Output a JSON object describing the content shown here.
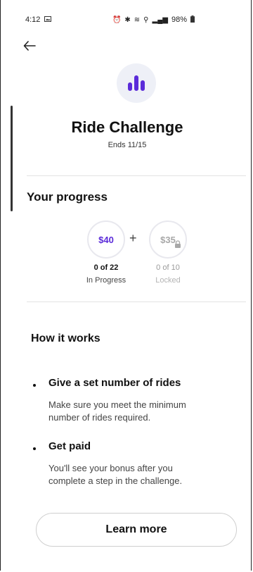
{
  "status_bar": {
    "time": "4:12",
    "battery": "98%",
    "icons": [
      "picture-icon",
      "alarm-icon",
      "bluetooth-icon",
      "wifi-icon",
      "location-icon",
      "signal-icon",
      "battery-icon"
    ]
  },
  "header": {
    "back_icon": "arrow-left-icon"
  },
  "challenge": {
    "icon": "bar-chart-icon",
    "title": "Ride Challenge",
    "ends": "Ends 11/15",
    "accent_color": "#5b2bd9"
  },
  "progress": {
    "heading": "Your progress",
    "plus": "+",
    "tiers": [
      {
        "amount": "$40",
        "count": "0 of 22",
        "status": "In Progress",
        "locked": false
      },
      {
        "amount": "$35",
        "count": "0 of 10",
        "status": "Locked",
        "locked": true
      }
    ]
  },
  "how_it_works": {
    "heading": "How it works",
    "steps": [
      {
        "title": "Give a set number of rides",
        "desc_line1": "Make sure you meet the minimum",
        "desc_line2": "number of rides required."
      },
      {
        "title": "Get paid",
        "desc_line1": "You'll see your bonus after you",
        "desc_line2": "complete a step in the challenge."
      }
    ]
  },
  "cta": {
    "learn_more": "Learn more"
  }
}
